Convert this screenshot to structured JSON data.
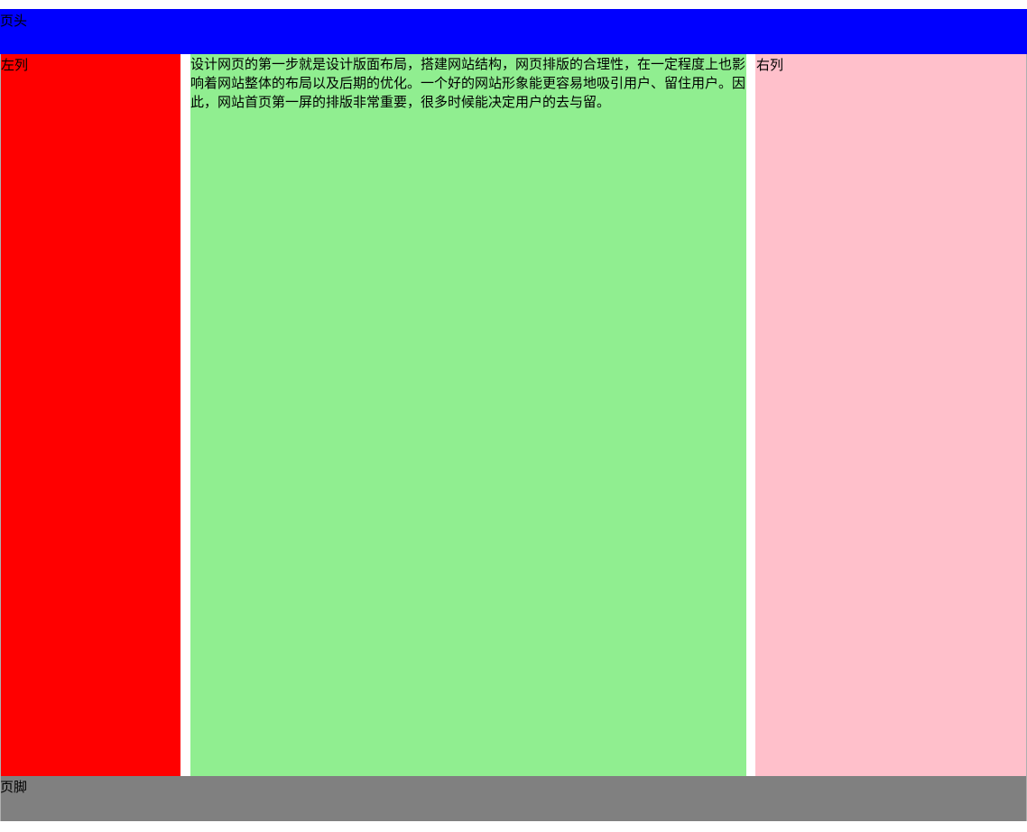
{
  "header": {
    "label": "页头"
  },
  "left_column": {
    "label": "左列"
  },
  "main_column": {
    "text": "设计网页的第一步就是设计版面布局，搭建网站结构，网页排版的合理性，在一定程度上也影响着网站整体的布局以及后期的优化。一个好的网站形象能更容易地吸引用户、留住用户。因此，网站首页第一屏的排版非常重要，很多时候能决定用户的去与留。"
  },
  "right_column": {
    "label": "右列"
  },
  "footer": {
    "label": "页脚"
  },
  "colors": {
    "header": "#0000ff",
    "left_column": "#ff0000",
    "main_column": "#90ee90",
    "right_column": "#ffc0cb",
    "footer": "#808080",
    "background": "#ffffff"
  }
}
